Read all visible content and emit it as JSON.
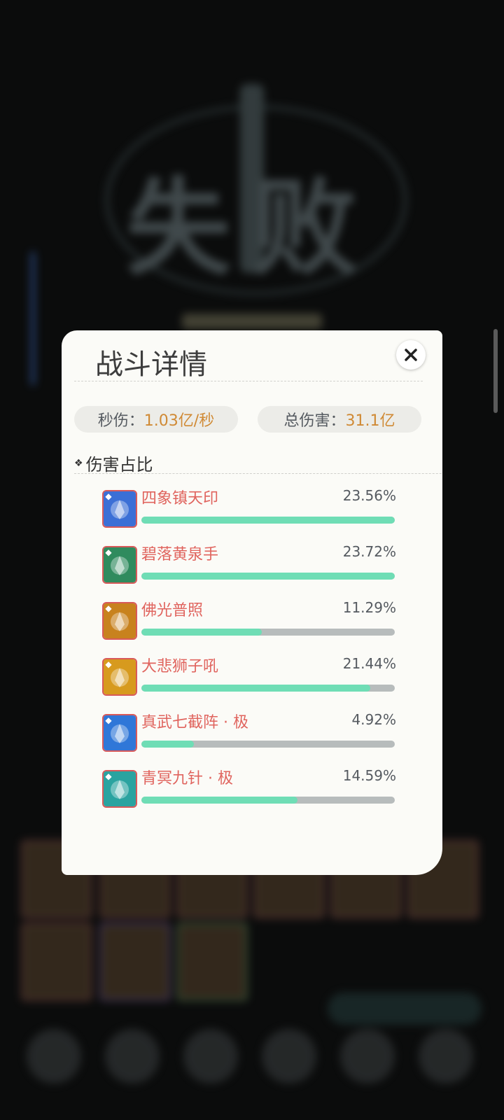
{
  "background": {
    "title": "失败"
  },
  "dialog": {
    "title": "战斗详情",
    "dps": {
      "label": "秒伤：",
      "value": "1.03亿/秒"
    },
    "total": {
      "label": "总伤害：",
      "value": "31.1亿"
    },
    "section_title": "伤害占比",
    "skills": [
      {
        "name": "四象镇天印",
        "percent": "23.56%",
        "fill": 1.0,
        "icon": "blue-seal-icon",
        "color": "#3b6fd6"
      },
      {
        "name": "碧落黄泉手",
        "percent": "23.72%",
        "fill": 1.0,
        "icon": "green-hand-icon",
        "color": "#2f8b5e"
      },
      {
        "name": "佛光普照",
        "percent": "11.29%",
        "fill": 0.476,
        "icon": "buddha-light-icon",
        "color": "#c8821e"
      },
      {
        "name": "大悲狮子吼",
        "percent": "21.44%",
        "fill": 0.904,
        "icon": "lion-roar-icon",
        "color": "#d79a1e"
      },
      {
        "name": "真武七截阵 · 极",
        "percent": "4.92%",
        "fill": 0.207,
        "icon": "blue-formation-icon",
        "color": "#2f77d8"
      },
      {
        "name": "青冥九针 · 极",
        "percent": "14.59%",
        "fill": 0.615,
        "icon": "green-needle-icon",
        "color": "#2aa3a0"
      }
    ]
  },
  "colors": {
    "accent_value": "#d08a35",
    "bar_fill": "#6fddb5",
    "bar_track": "#b7bcbc",
    "skill_name": "#e0645e"
  }
}
